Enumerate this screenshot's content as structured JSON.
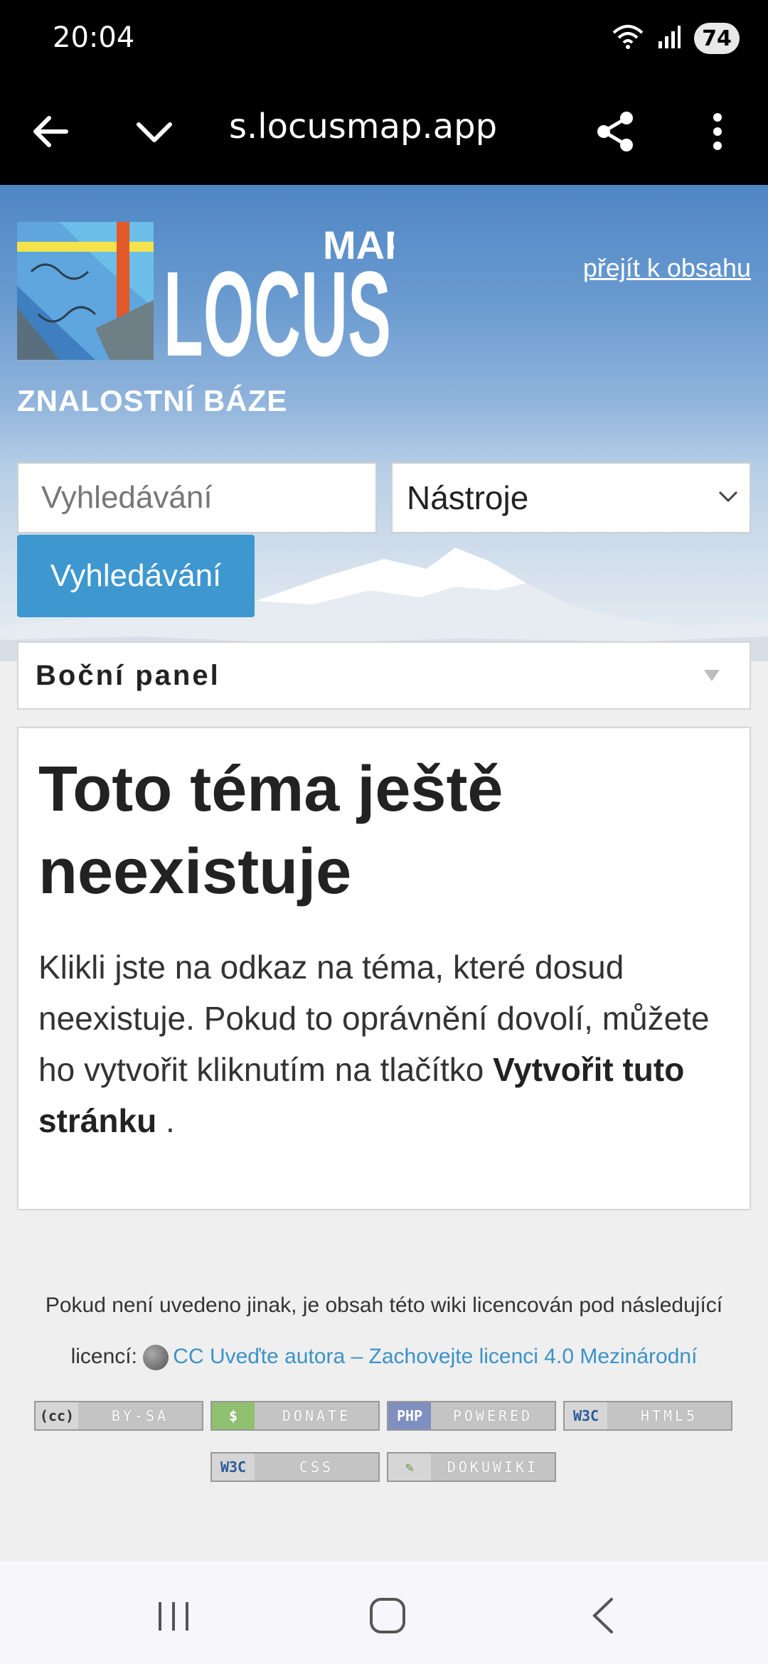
{
  "status_bar": {
    "time": "20:04",
    "battery": "74"
  },
  "browser": {
    "url": "s.locusmap.app"
  },
  "header": {
    "logo_main": "LOCUS",
    "logo_sub": "MAP",
    "skip_link": "přejít k obsahu",
    "kb_title": "ZNALOSTNÍ BÁZE"
  },
  "search": {
    "placeholder": "Vyhledávání",
    "tools_selected": "Nástroje",
    "button": "Vyhledávání"
  },
  "sidebar": {
    "label": "Boční panel"
  },
  "content": {
    "title": "Toto téma ještě neexistuje",
    "text_before": "Klikli jste na odkaz na téma, které dosud neexistuje. Pokud to oprávnění dovolí, můžete ho vytvořit kliknutím na tlačítko ",
    "text_bold": "Vytvořit tuto stránku",
    "text_after": " ."
  },
  "footer": {
    "license_prefix": "Pokud není uvedeno jinak, je obsah této wiki licencován pod následující licencí:",
    "license_link": "CC Uveďte autora – Zachovejte licenci 4.0 Mezinárodní",
    "badges": [
      {
        "left": "(cc)",
        "right": "BY-SA",
        "color": "#d6d6d6"
      },
      {
        "left": "$",
        "right": "DONATE",
        "color": "#8fbf6f"
      },
      {
        "left": "PHP",
        "right": "POWERED",
        "color": "#7f8fbf"
      },
      {
        "left": "W3C",
        "right": "HTML5",
        "color": "#d6d6d6"
      },
      {
        "left": "W3C",
        "right": "CSS",
        "color": "#d6d6d6"
      },
      {
        "left": "✎",
        "right": "DOKUWIKI",
        "color": "#d6d6d6"
      }
    ]
  },
  "colors": {
    "accent": "#3e97cf",
    "link": "#3a92c7"
  }
}
